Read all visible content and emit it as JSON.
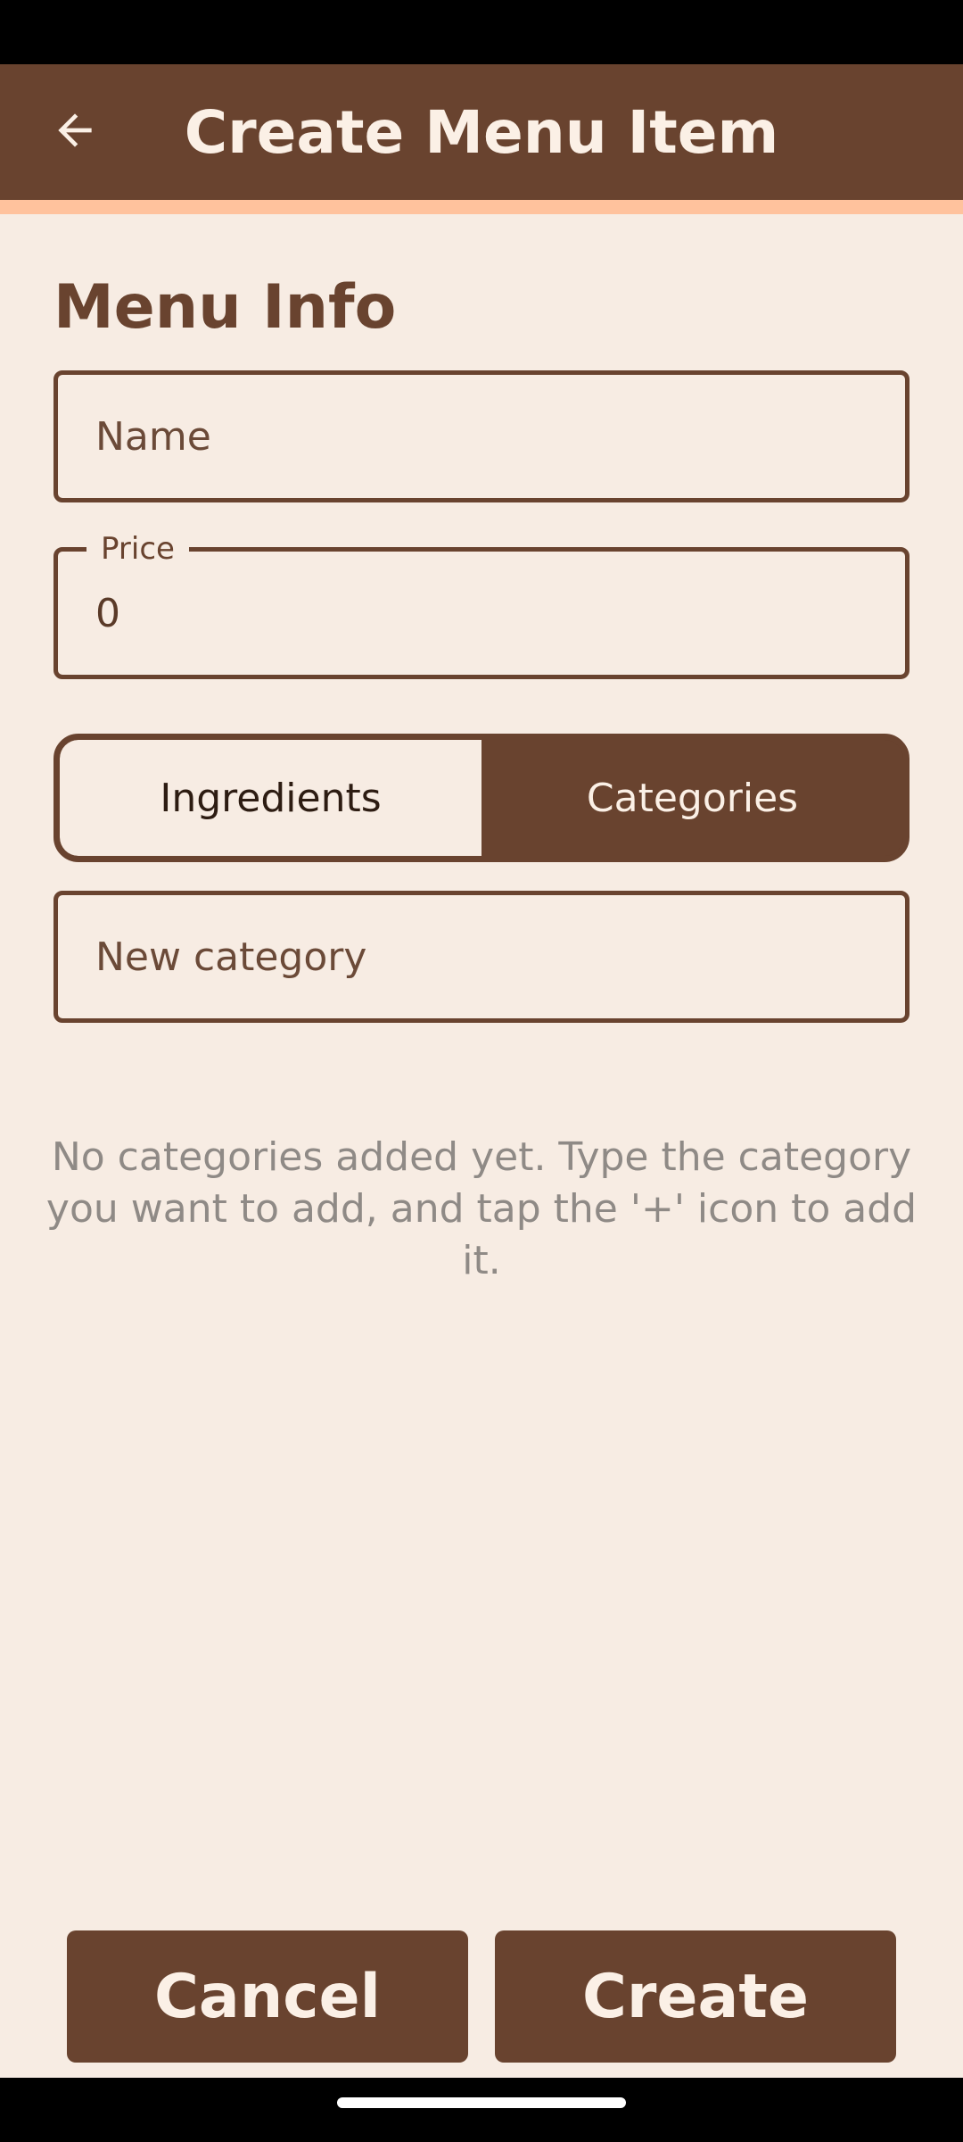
{
  "app_bar": {
    "title": "Create Menu Item",
    "back_icon": "arrow-left-icon"
  },
  "menu_info": {
    "section_title": "Menu Info",
    "name_field": {
      "placeholder": "Name",
      "value": ""
    },
    "price_field": {
      "label": "Price",
      "value": "0"
    }
  },
  "tabs": {
    "items": [
      {
        "label": "Ingredients",
        "selected": false
      },
      {
        "label": "Categories",
        "selected": true
      }
    ]
  },
  "category_input": {
    "placeholder": "New category",
    "value": ""
  },
  "empty_state": {
    "message": "No categories added yet. Type the category you want to add, and tap the '+' icon to add it."
  },
  "actions": {
    "cancel_label": "Cancel",
    "create_label": "Create"
  },
  "colors": {
    "primary": "#69432f",
    "accent": "#ffc29d",
    "background": "#f7ece3",
    "on_primary": "#fbf0e6",
    "muted_text": "#8f8a86"
  }
}
